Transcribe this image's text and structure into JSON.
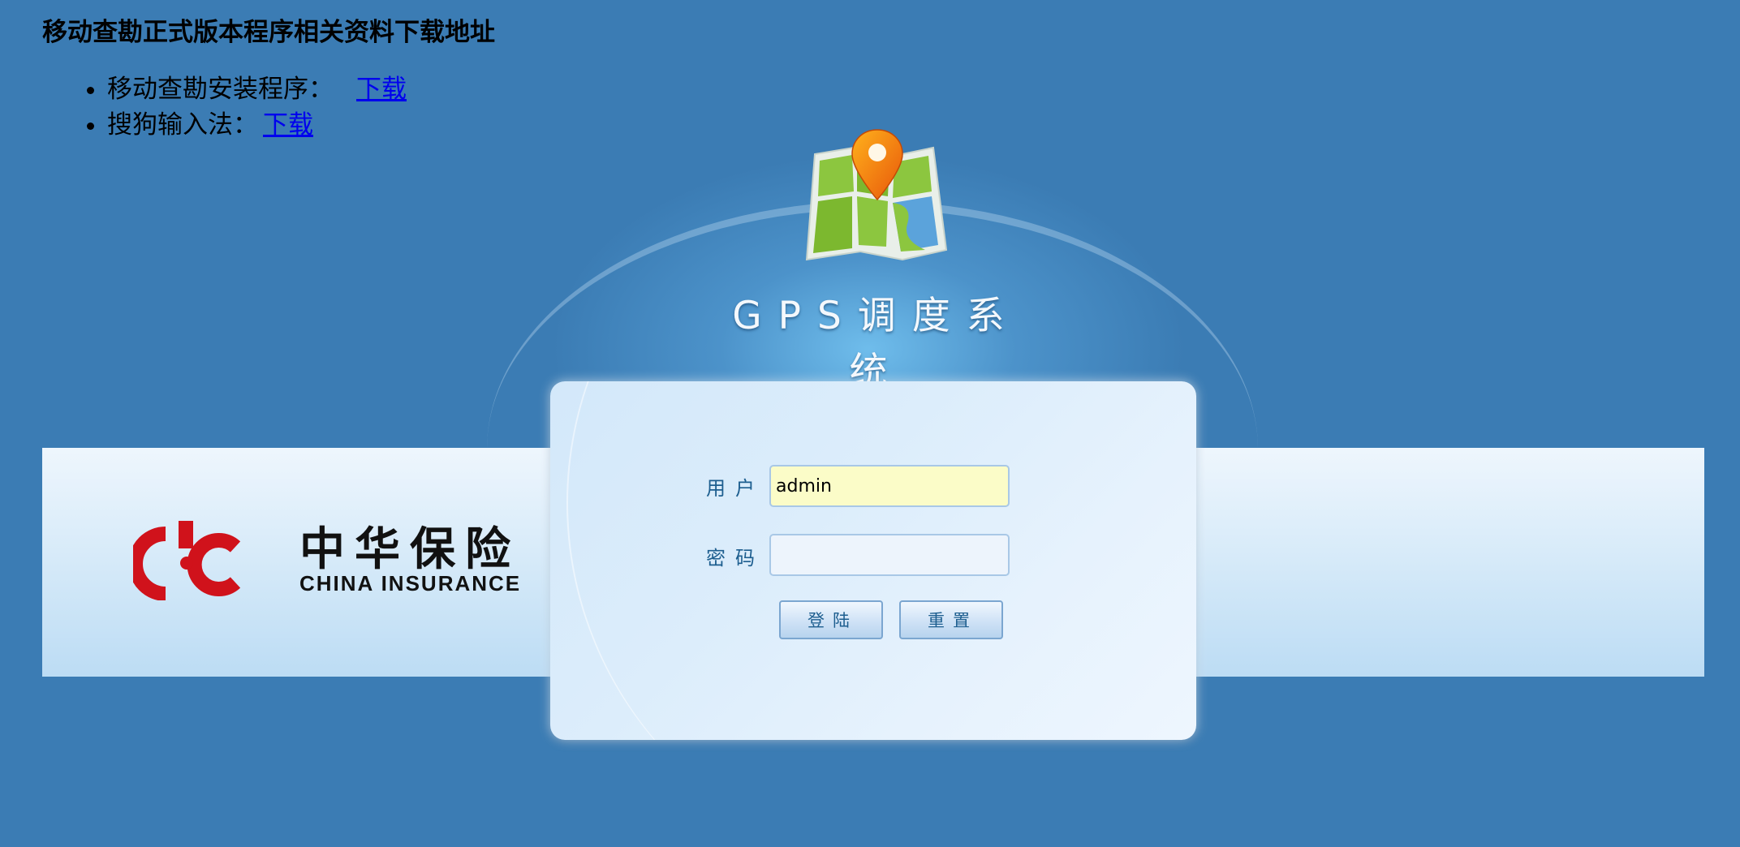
{
  "page": {
    "heading": "移动查勘正式版本程序相关资料下载地址",
    "downloads": [
      {
        "label": "移动查勘安装程序：",
        "link": "下载"
      },
      {
        "label": "搜狗输入法：",
        "link": "下载"
      }
    ]
  },
  "system": {
    "title": "GPS调度系统"
  },
  "brand": {
    "name_cn": "中华保险",
    "name_en": "CHINA  INSURANCE"
  },
  "login": {
    "user_label": "用户",
    "user_value": "admin",
    "password_label": "密码",
    "password_value": "",
    "login_button": "登陆",
    "reset_button": "重置"
  },
  "colors": {
    "background": "#3b7cb4",
    "brand_red": "#d0121b",
    "label_blue": "#1d5e8f",
    "link": "#0000ee"
  },
  "icons": {
    "map": "map-pin-icon",
    "logo": "china-insurance-logo"
  }
}
